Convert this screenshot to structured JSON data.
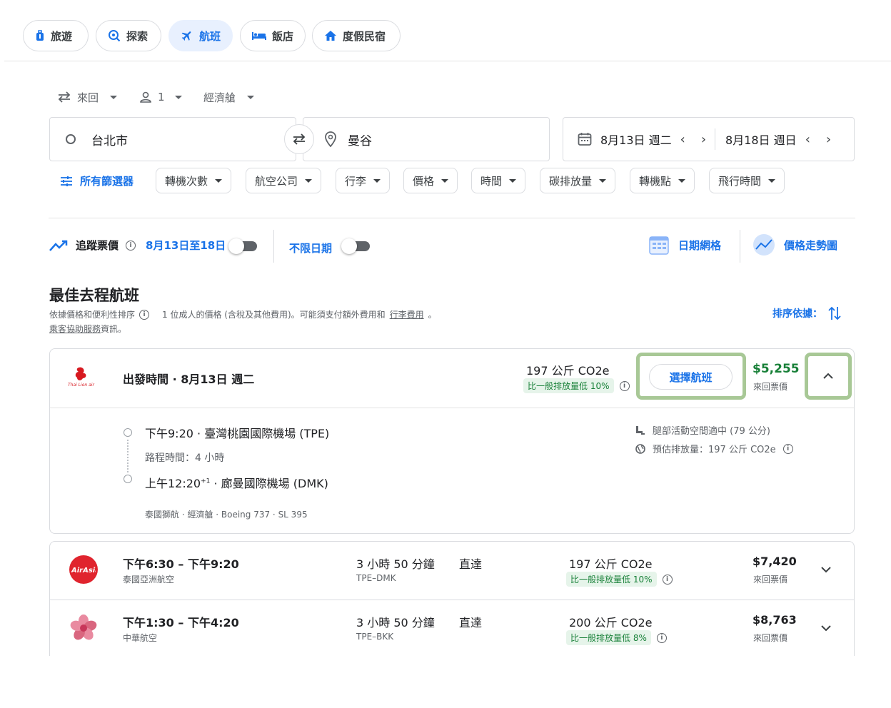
{
  "nav": {
    "tabs": [
      {
        "label": "旅遊",
        "icon": "luggage-icon"
      },
      {
        "label": "探索",
        "icon": "explore-icon"
      },
      {
        "label": "航班",
        "icon": "airplane-icon",
        "active": true
      },
      {
        "label": "飯店",
        "icon": "bed-icon"
      },
      {
        "label": "度假民宿",
        "icon": "home-icon"
      }
    ]
  },
  "search": {
    "trip_type": "來回",
    "passengers": "1",
    "cabin": "經濟艙",
    "origin": "台北市",
    "destination": "曼谷",
    "depart_date": "8月13日 週二",
    "return_date": "8月18日 週日"
  },
  "filters": {
    "all_label": "所有篩選器",
    "items": [
      "轉機次數",
      "航空公司",
      "行李",
      "價格",
      "時間",
      "碳排放量",
      "轉機點",
      "飛行時間"
    ]
  },
  "tools": {
    "track_label": "追蹤票價",
    "track_dates": "8月13日至18日",
    "any_dates_label": "不限日期",
    "date_grid_label": "日期網格",
    "price_graph_label": "價格走勢圖"
  },
  "results": {
    "heading": "最佳去程航班",
    "sort_note": "依據價格和便利性排序",
    "price_note": "1 位成人的價格 (含稅及其他費用)。可能須支付額外費用和",
    "baggage_link": "行李費用",
    "assist_link": "乘客協助服務",
    "assist_suffix": "資訊。",
    "sort_by_label": "排序依據："
  },
  "expanded": {
    "airline_logo": "thai-lion-air-logo",
    "title": "出發時間 · 8月13日 週二",
    "emissions": "197 公斤 CO2e",
    "emissions_badge": "比一般排放量低 10%",
    "select_label": "選擇航班",
    "price": "$5,255",
    "price_note": "來回票價",
    "depart_line": "下午9:20 · 臺灣桃園國際機場 (TPE)",
    "duration_line": "路程時間：4 小時",
    "arrive_time": "上午12:20",
    "arrive_sup": "+1",
    "arrive_line": " · 廊曼國際機場 (DMK)",
    "details_line": "泰國獅航 · 經濟艙 · Boeing 737 · SL 395",
    "legroom": "腿部活動空間適中 (79 公分)",
    "est_emissions": "預估排放量：197 公斤 CO2e"
  },
  "flights": [
    {
      "logo": "airasia-logo",
      "times": "下午6:30 – 下午9:20",
      "airline": "泰國亞洲航空",
      "duration": "3 小時 50 分鐘",
      "route": "TPE–DMK",
      "stops": "直達",
      "emissions": "197 公斤 CO2e",
      "badge": "比一般排放量低 10%",
      "price": "$7,420",
      "price_note": "來回票價"
    },
    {
      "logo": "china-airlines-logo",
      "times": "下午1:30 – 下午4:20",
      "airline": "中華航空",
      "duration": "3 小時 50 分鐘",
      "route": "TPE–BKK",
      "stops": "直達",
      "emissions": "200 公斤 CO2e",
      "badge": "比一般排放量低 8%",
      "price": "$8,763",
      "price_note": "來回票價"
    }
  ],
  "colors": {
    "accent": "#1a73e8",
    "price_green": "#188038",
    "highlight": "#a8c896"
  }
}
